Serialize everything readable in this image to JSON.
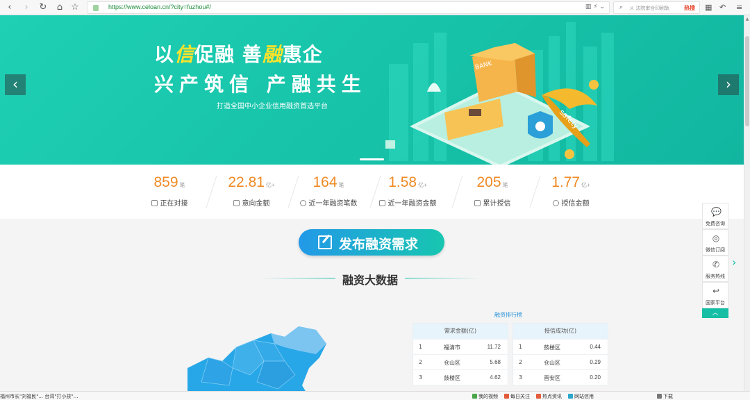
{
  "browser": {
    "url": "https://www.celoan.cn/?city=fuzhou#/",
    "search_placeholder": "ㄨ 法院审合印刷轨",
    "hot_label": "热搜"
  },
  "banner": {
    "slogan_line1_a": "以",
    "slogan_line1_b": "信",
    "slogan_line1_c": "促融  善",
    "slogan_line1_d": "融",
    "slogan_line1_e": "惠企",
    "slogan_line2": "兴产筑信 产融共生",
    "slogan_sub": "打造全国中小企业信用融资首选平台",
    "prev_label": "‹",
    "next_label": "›"
  },
  "stats": [
    {
      "value": "859",
      "unit": "笔",
      "label": "正在对接"
    },
    {
      "value": "22.81",
      "unit": "亿+",
      "label": "意向金额"
    },
    {
      "value": "164",
      "unit": "笔",
      "label": "近一年融资笔数"
    },
    {
      "value": "1.58",
      "unit": "亿+",
      "label": "近一年融资金额"
    },
    {
      "value": "205",
      "unit": "笔",
      "label": "累计授信"
    },
    {
      "value": "1.77",
      "unit": "亿+",
      "label": "授信金额"
    }
  ],
  "publish_button": "发布融资需求",
  "section_title": "融资大数据",
  "ranking": {
    "title": "融资排行榜",
    "left": {
      "header": "需求金额(亿)",
      "rows": [
        {
          "rank": "1",
          "area": "福清市",
          "value": "11.72"
        },
        {
          "rank": "2",
          "area": "仓山区",
          "value": "5.68"
        },
        {
          "rank": "3",
          "area": "鼓楼区",
          "value": "4.62"
        }
      ]
    },
    "right": {
      "header": "授信成功(亿)",
      "rows": [
        {
          "rank": "1",
          "area": "鼓楼区",
          "value": "0.44"
        },
        {
          "rank": "2",
          "area": "仓山区",
          "value": "0.29"
        },
        {
          "rank": "3",
          "area": "晋安区",
          "value": "0.20"
        }
      ]
    }
  },
  "side_bar": [
    {
      "label": "免费咨询",
      "icon": "chat-icon"
    },
    {
      "label": "微信订阅",
      "icon": "wechat-icon"
    },
    {
      "label": "服务热线",
      "icon": "phone-icon"
    },
    {
      "label": "国家平台",
      "icon": "return-icon"
    }
  ],
  "status_bar": {
    "news": "福州市长\"刘福民\"... 台湾\"打小孩\"...",
    "items": [
      "我的视频",
      "每日关注",
      "热点资讯",
      "网站信用",
      "下载"
    ]
  },
  "colors": {
    "accent": "#16bea6",
    "number": "#f08a24",
    "link": "#2a92d9"
  }
}
